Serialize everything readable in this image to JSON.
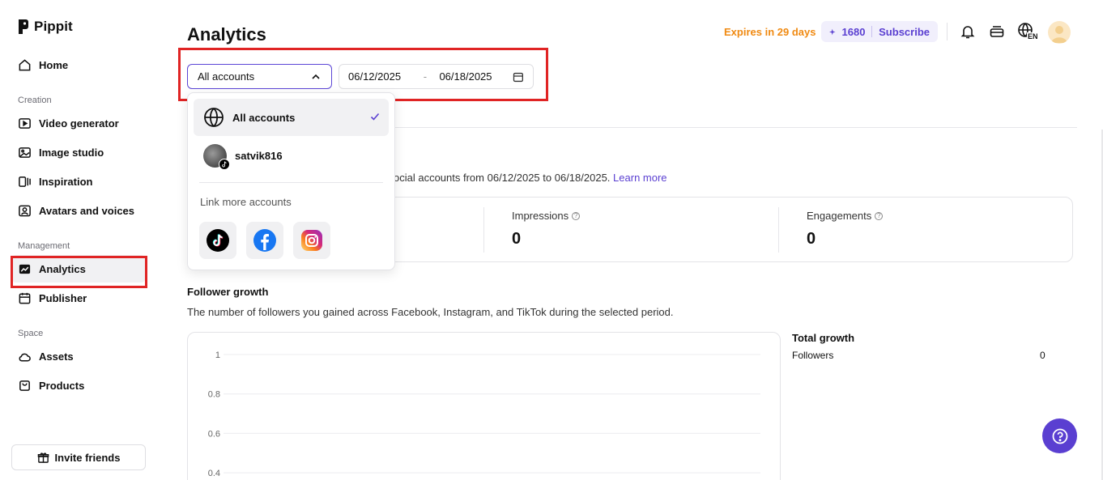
{
  "brand": {
    "name": "Pippit"
  },
  "sidebar": {
    "home": "Home",
    "sections": {
      "creation": "Creation",
      "management": "Management",
      "space": "Space"
    },
    "creation_items": [
      "Video generator",
      "Image studio",
      "Inspiration",
      "Avatars and voices"
    ],
    "management_items": [
      "Analytics",
      "Publisher"
    ],
    "space_items": [
      "Assets",
      "Products"
    ],
    "active": "Analytics",
    "invite": "Invite friends"
  },
  "header": {
    "title": "Analytics",
    "expires": "Expires in 29 days",
    "credits": "1680",
    "subscribe": "Subscribe",
    "language": "EN"
  },
  "filters": {
    "account": "All accounts",
    "date_start": "06/12/2025",
    "date_sep": "-",
    "date_end": "06/18/2025"
  },
  "dropdown": {
    "options": [
      {
        "label": "All accounts",
        "selected": true
      },
      {
        "label": "satvik816",
        "selected": false
      }
    ],
    "link_more": "Link more accounts",
    "socials": [
      "tiktok",
      "facebook",
      "instagram"
    ]
  },
  "overview": {
    "desc_partial": "ocial accounts from 06/12/2025 to 06/18/2025.",
    "learn_more": "Learn more",
    "stats": [
      {
        "label": "Impressions",
        "value": "0"
      },
      {
        "label": "Engagements",
        "value": "0"
      }
    ]
  },
  "follower_growth": {
    "title": "Follower growth",
    "desc": "The number of followers you gained across Facebook, Instagram, and TikTok during the selected period.",
    "total_title": "Total growth",
    "total_label": "Followers",
    "total_value": "0"
  },
  "chart_data": {
    "type": "line",
    "y_ticks": [
      "1",
      "0.8",
      "0.6",
      "0.4"
    ],
    "ylim": [
      0,
      1
    ],
    "series": [],
    "grid": true
  },
  "colors": {
    "accent": "#5a3fd1",
    "warning": "#f08a12",
    "highlight": "#e02424"
  }
}
